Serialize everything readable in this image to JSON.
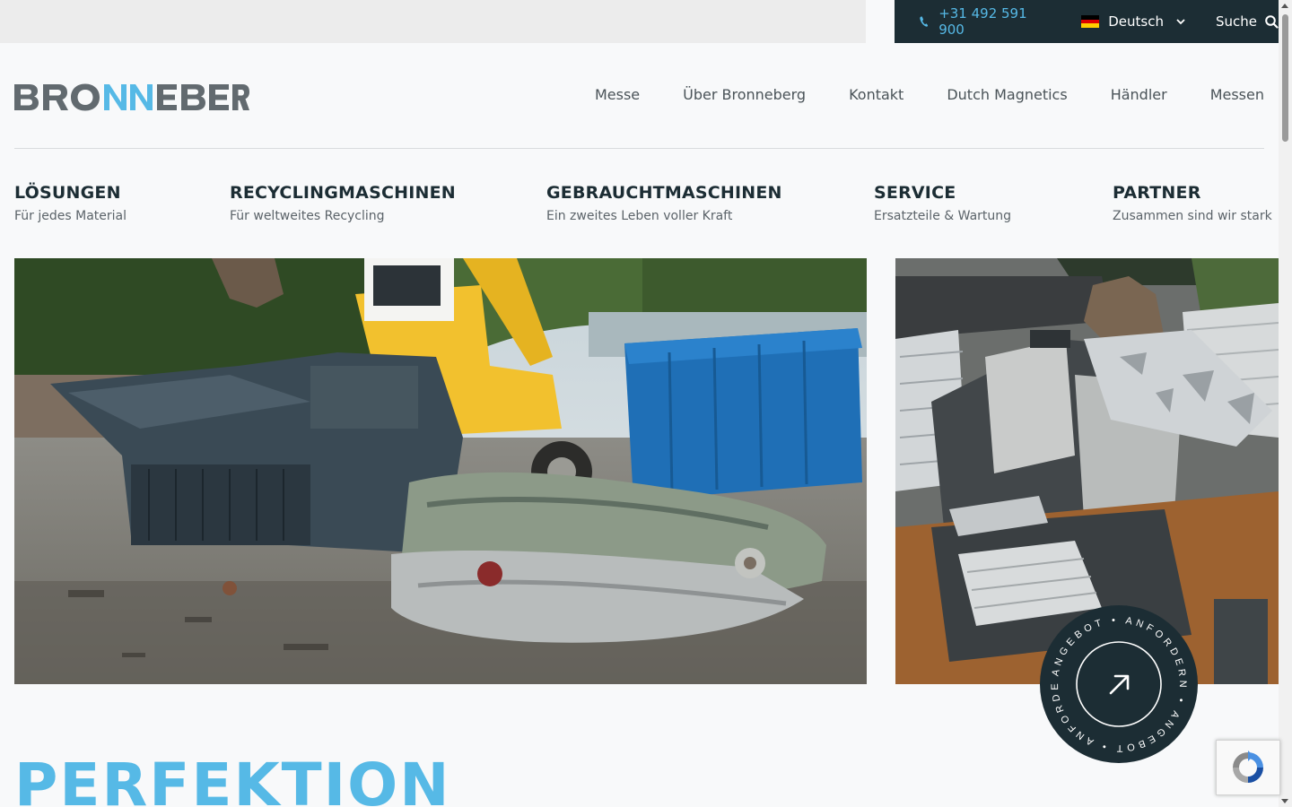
{
  "topbar": {
    "phone": "+31 492 591 900",
    "language": "Deutsch",
    "search_label": "Suche"
  },
  "brand": {
    "logo_text": "BRONNEBERG"
  },
  "nav": {
    "items": [
      {
        "label": "Messe"
      },
      {
        "label": "Über Bronneberg"
      },
      {
        "label": "Kontakt"
      },
      {
        "label": "Dutch Magnetics"
      },
      {
        "label": "Händler"
      },
      {
        "label": "Messen"
      }
    ]
  },
  "categories": [
    {
      "title": "LÖSUNGEN",
      "subtitle": "Für jedes Material"
    },
    {
      "title": "RECYCLINGMASCHINEN",
      "subtitle": "Für weltweites Recycling"
    },
    {
      "title": "GEBRAUCHTMASCHINEN",
      "subtitle": "Ein zweites Leben voller Kraft"
    },
    {
      "title": "SERVICE",
      "subtitle": "Ersatzteile & Wartung"
    },
    {
      "title": "PARTNER",
      "subtitle": "Zusammen sind wir stark"
    }
  ],
  "badge": {
    "text": "ANGEBOT • ANFORDERN • ANGEBOT • ANFORDERN •"
  },
  "headline": "PERFEKTION",
  "colors": {
    "accent": "#56b9e6",
    "dark": "#1c2d34",
    "text": "#4a5358"
  }
}
